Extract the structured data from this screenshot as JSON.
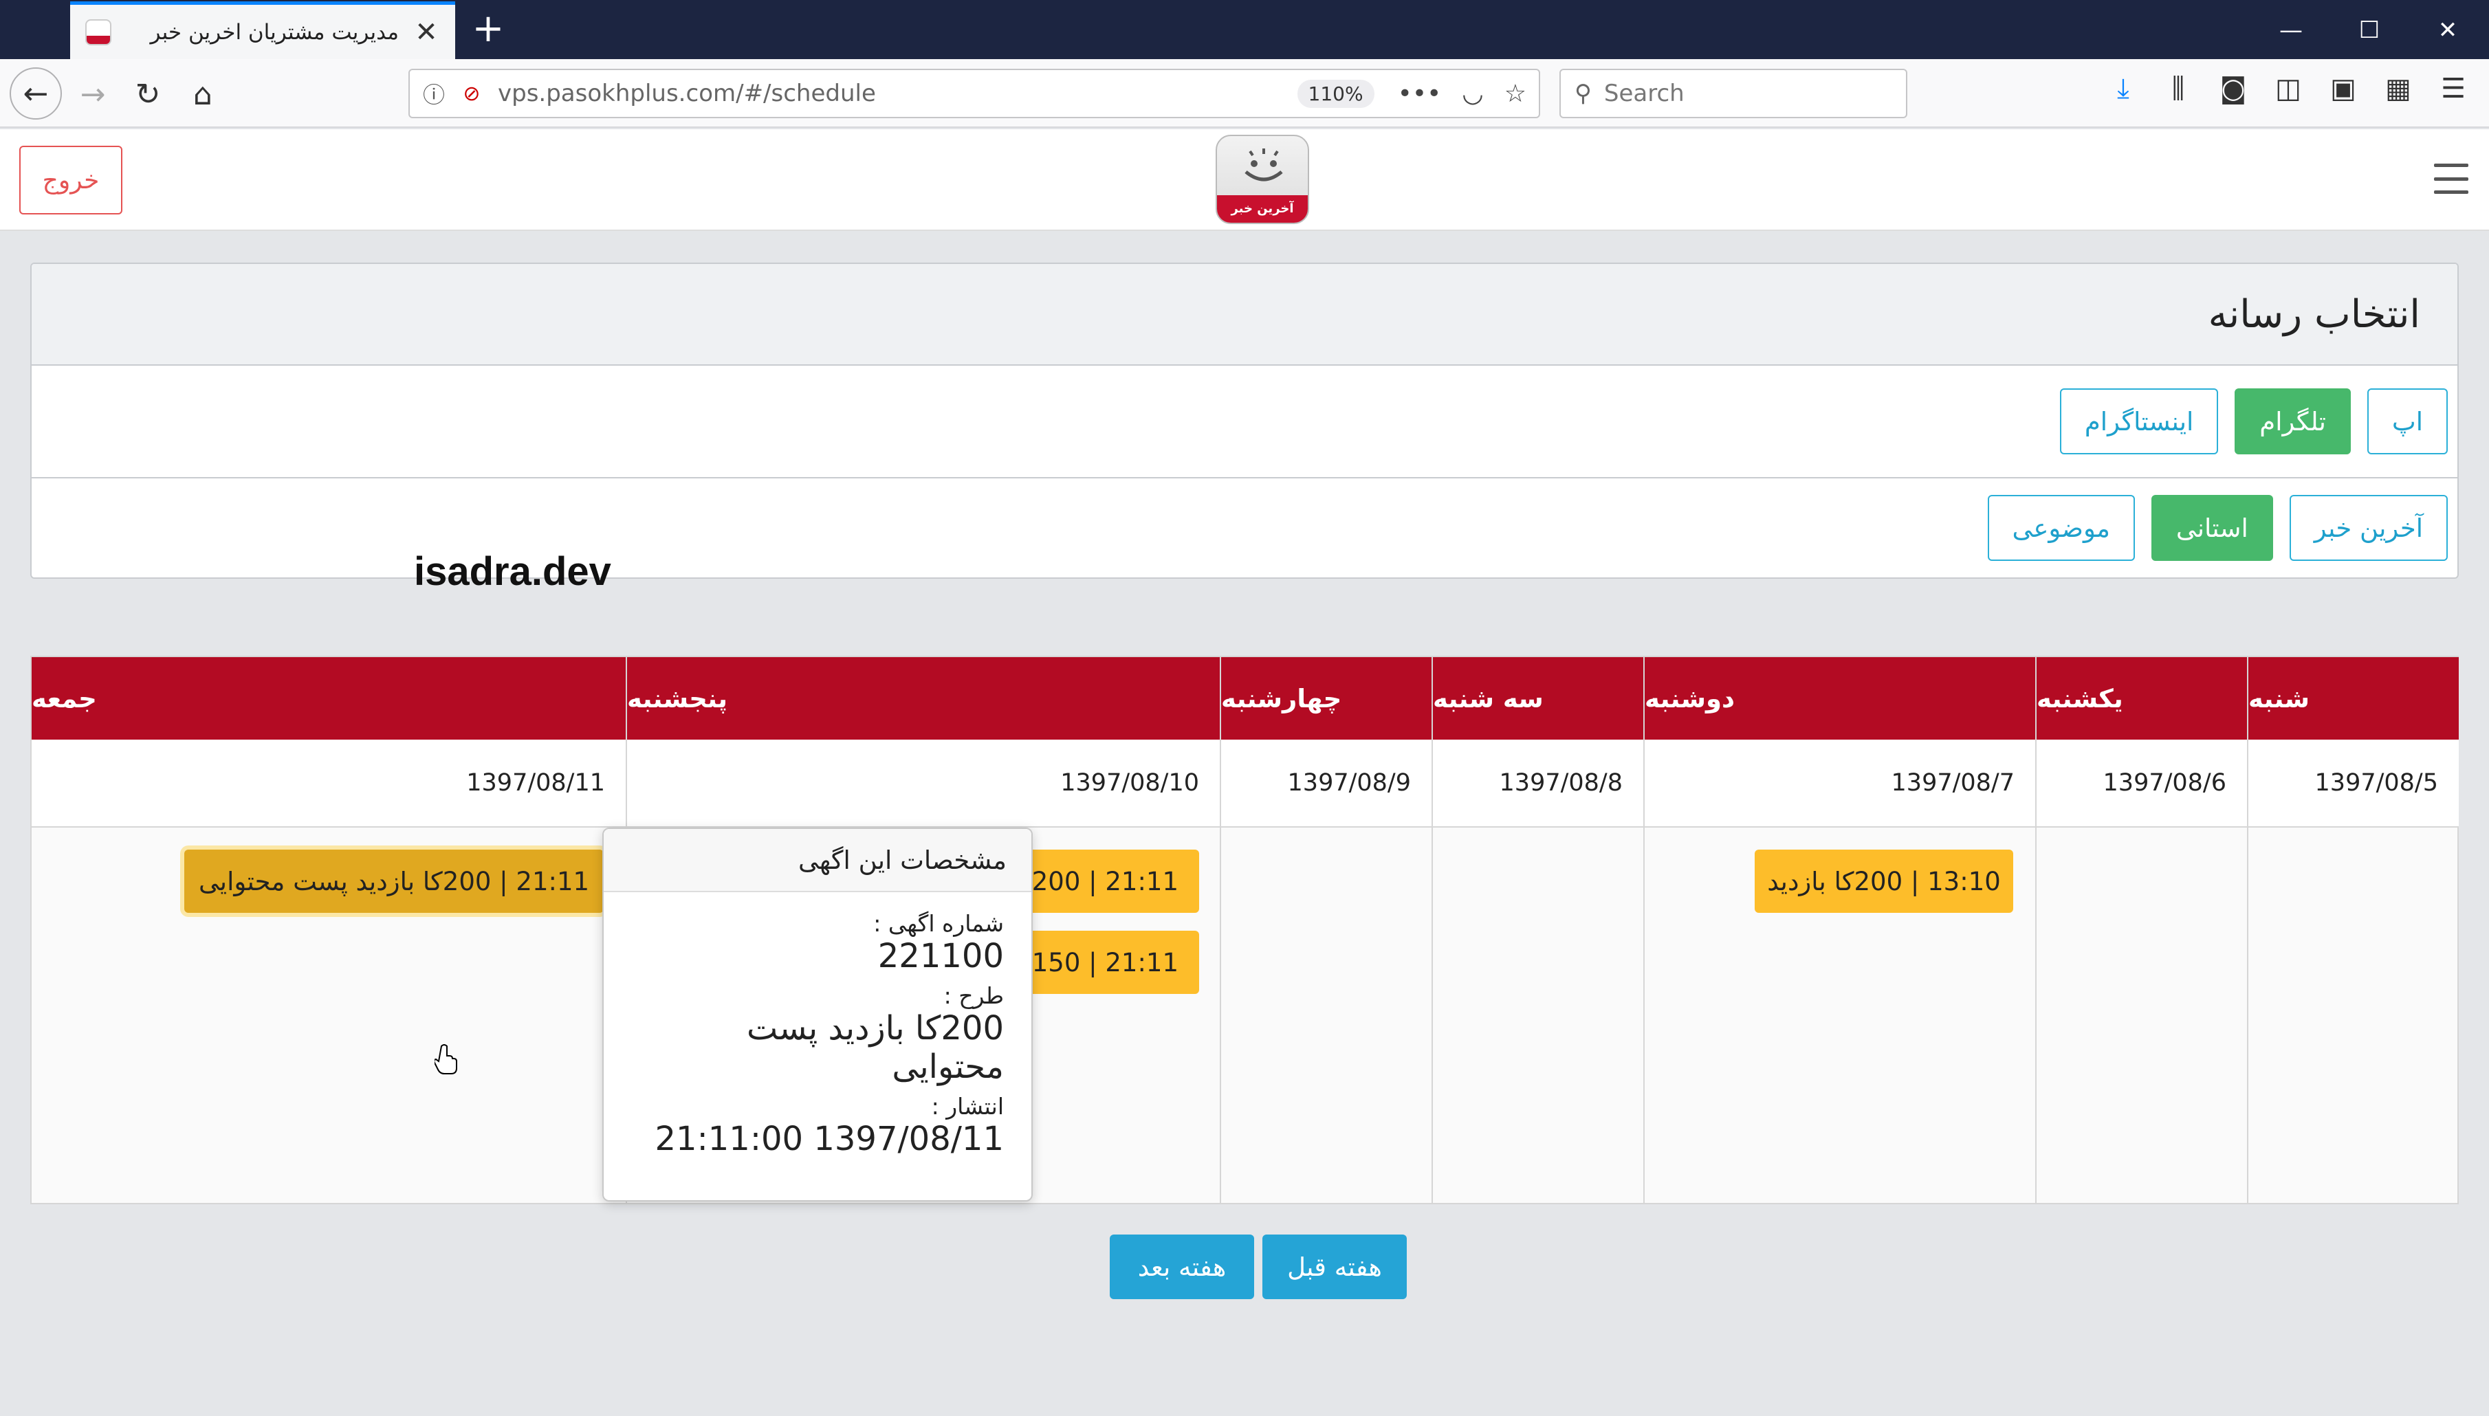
{
  "browser": {
    "tab_title": "مدیریت مشتریان اخرین خبر",
    "url": "vps.pasokhplus.com/#/schedule",
    "zoom": "110%",
    "search_placeholder": "Search"
  },
  "app": {
    "logout_label": "خروج",
    "logo_text": "آخرین خبر"
  },
  "media_select": {
    "title": "انتخاب رسانه",
    "platforms": [
      "اپ",
      "تلگرام",
      "اینستاگرام"
    ],
    "channels": [
      "آخرین خبر",
      "استانی",
      "موضوعی"
    ],
    "active_platform": "تلگرام",
    "active_channel": "استانی"
  },
  "watermark": "isadra.dev",
  "schedule": {
    "days": [
      {
        "name": "شنبه",
        "date": "1397/08/5",
        "ads": []
      },
      {
        "name": "یکشنبه",
        "date": "1397/08/6",
        "ads": []
      },
      {
        "name": "دوشنبه",
        "date": "1397/08/7",
        "ads": [
          "13:10 | 200کا بازدید"
        ]
      },
      {
        "name": "سه شنبه",
        "date": "1397/08/8",
        "ads": []
      },
      {
        "name": "چهارشنبه",
        "date": "1397/08/9",
        "ads": []
      },
      {
        "name": "پنجشنبه",
        "date": "1397/08/10",
        "ads": [
          "21:11 | 200کا",
          "21:11 | 150کا"
        ]
      },
      {
        "name": "جمعه",
        "date": "1397/08/11",
        "ads": [
          "21:11 | 200کا بازدید پست محتوایی"
        ]
      }
    ]
  },
  "popover": {
    "title": "مشخصات این اگهی",
    "ad_number_label": "شماره اگهی :",
    "ad_number": "221100",
    "plan_label": "طرح :",
    "plan": "200کا بازدید پست محتوایی",
    "publish_label": "انتشار :",
    "publish": "1397/08/11 21:11:00"
  },
  "pager": {
    "next_week": "هفته بعد",
    "prev_week": "هفته قبل"
  },
  "colors": {
    "header_red": "#b30b23",
    "chip_yellow": "#fdbd2a",
    "active_green": "#47b86b",
    "accent_blue": "#25a4d6",
    "danger": "#e55353"
  }
}
